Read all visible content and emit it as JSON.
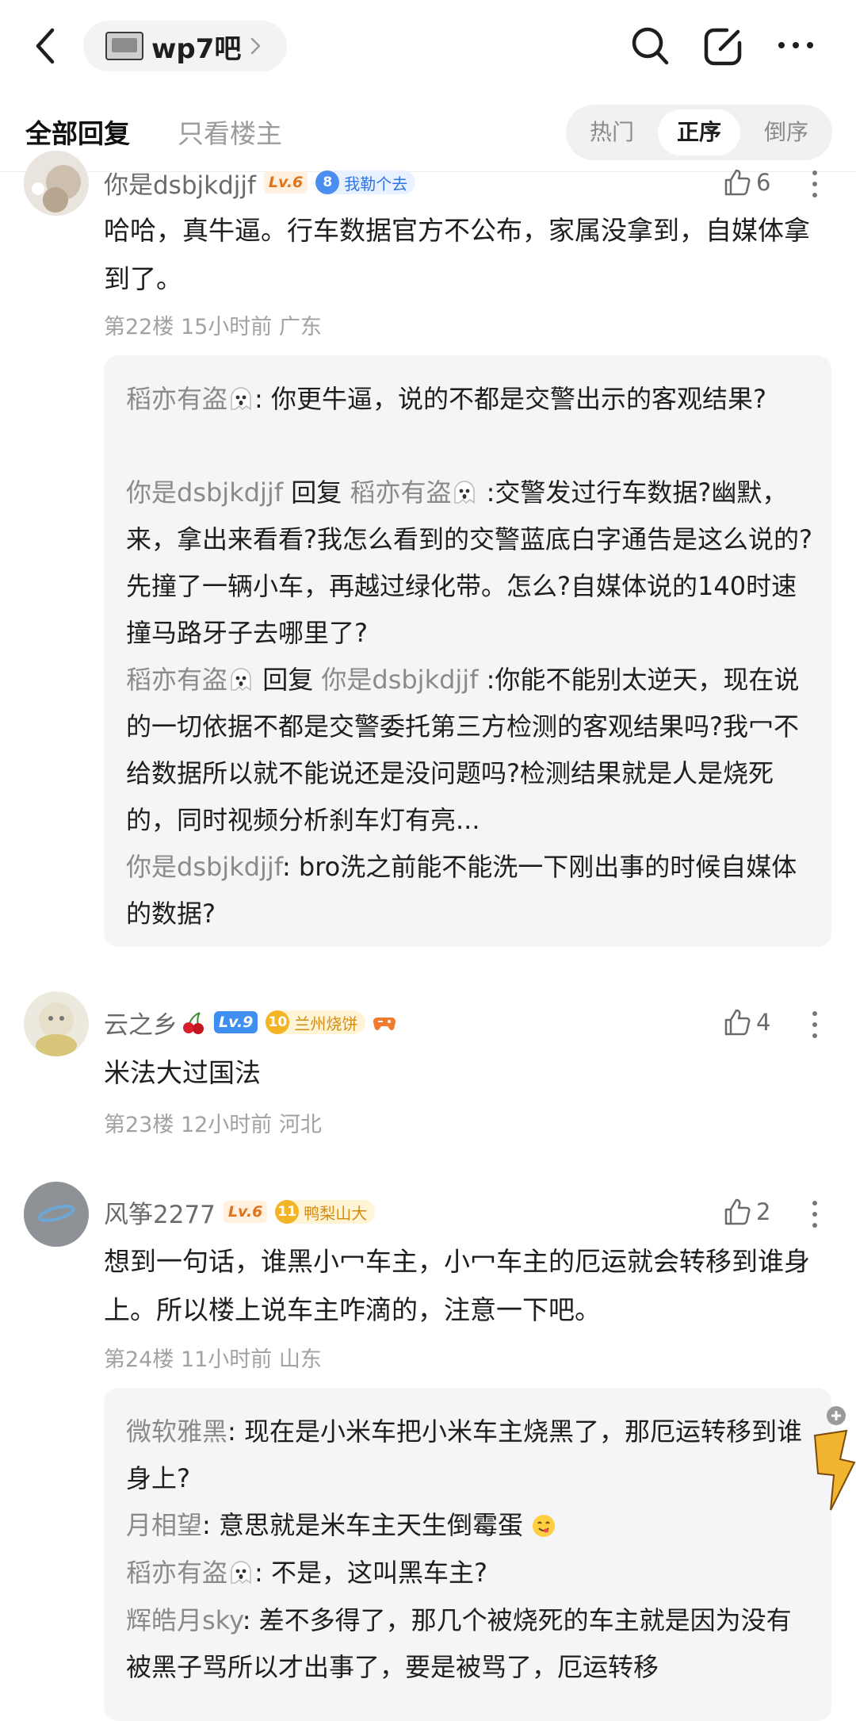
{
  "header": {
    "forum_name": "wp7吧",
    "icons": [
      "back-icon",
      "search-icon",
      "edit-icon",
      "more-icon"
    ]
  },
  "tabs": {
    "all": "全部回复",
    "op_only": "只看楼主",
    "sort": [
      "热门",
      "正序",
      "倒序"
    ],
    "active_sort": "正序"
  },
  "comments": [
    {
      "user": "你是dsbjkdjjf",
      "level": "Lv.6",
      "badge_num": "8",
      "badge_text": "我勒个去",
      "likes": "6",
      "text": "哈哈，真牛逼。行车数据官方不公布，家属没拿到，自媒体拿到了。",
      "meta": "第22楼 15小时前 广东",
      "replies": [
        {
          "from": "稻亦有盗",
          "to": "",
          "text": "你更牛逼，说的不都是交警出示的客观结果?"
        },
        {
          "from": "你是dsbjkdjjf",
          "to": "稻亦有盗",
          "text": ":交警发过行车数据?幽默，来，拿出来看看?我怎么看到的交警蓝底白字通告是这么说的?先撞了一辆小车，再越过绿化带。怎么?自媒体说的140时速撞马路牙子去哪里了?"
        },
        {
          "from": "稻亦有盗",
          "to": "你是dsbjkdjjf",
          "text": ":你能不能别太逆天，现在说的一切依据不都是交警委托第三方检测的客观结果吗?我冖不给数据所以就不能说还是没问题吗?检测结果就是人是烧死的，同时视频分析刹车灯有亮..."
        },
        {
          "from": "你是dsbjkdjjf",
          "to": "",
          "text": "bro洗之前能不能洗一下刚出事的时候自媒体的数据?"
        }
      ]
    },
    {
      "user": "云之乡",
      "level": "Lv.9",
      "badge_num": "10",
      "badge_text": "兰州烧饼",
      "likes": "4",
      "text": "米法大过国法",
      "meta": "第23楼 12小时前 河北"
    },
    {
      "user": "风筝2277",
      "level": "Lv.6",
      "badge_num": "11",
      "badge_text": "鸭梨山大",
      "likes": "2",
      "text": "想到一句话，谁黑小冖车主，小冖车主的厄运就会转移到谁身上。所以楼上说车主咋滴的，注意一下吧。",
      "meta": "第24楼 11小时前 山东",
      "replies": [
        {
          "from": "微软雅黑",
          "text": "现在是小米车把小米车主烧黑了，那厄运转移到谁身上?"
        },
        {
          "from": "月相望",
          "text": "意思就是米车主天生倒霉蛋"
        },
        {
          "from": "稻亦有盗",
          "text": "不是，这叫黑车主?"
        },
        {
          "from": "辉皓月sky",
          "text": "差不多得了，那几个被烧死的车主就是因为没有被黑子骂所以才出事了，要是被骂了，厄运转移"
        }
      ]
    }
  ],
  "labels": {
    "reply_word": "回复",
    "colon": ":",
    "ghost": "👻"
  }
}
